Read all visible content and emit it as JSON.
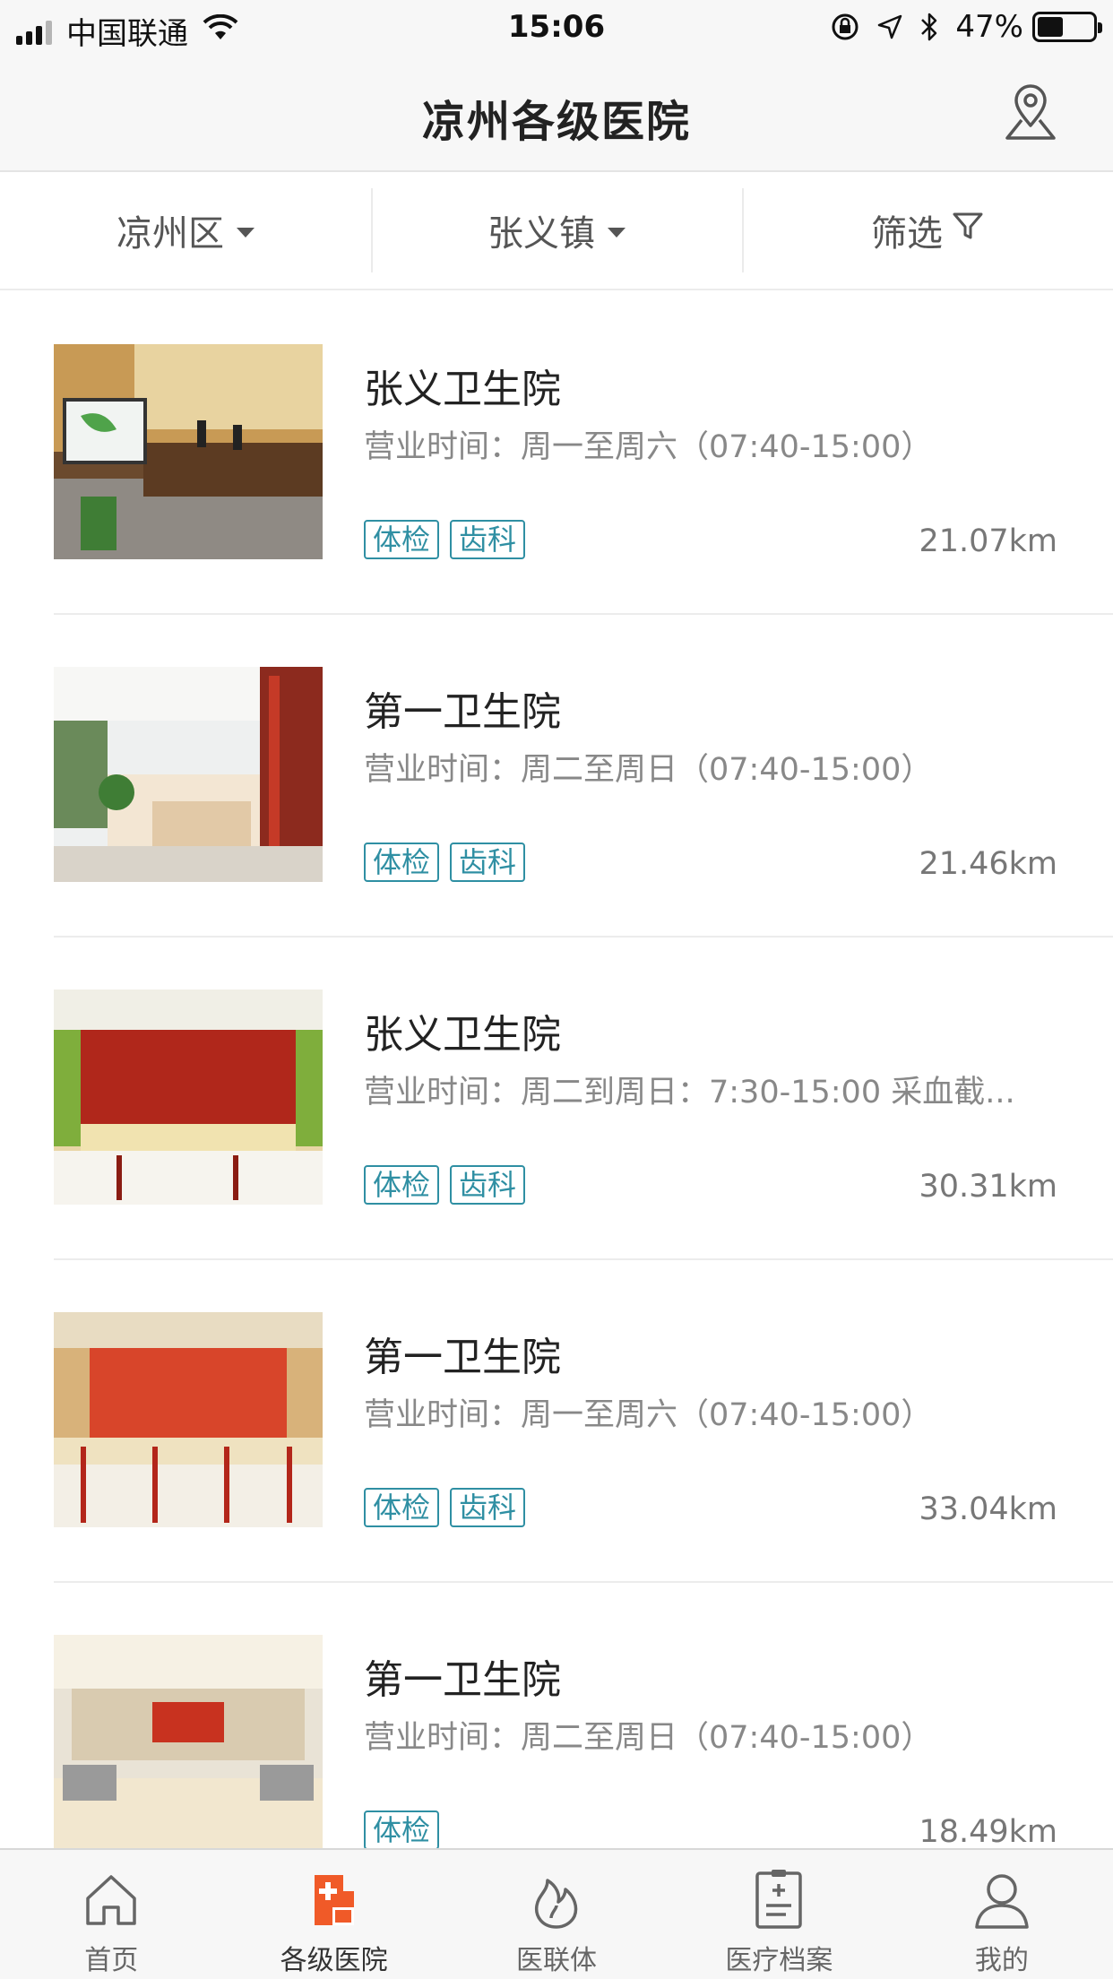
{
  "status_bar": {
    "carrier": "中国联通",
    "time": "15:06",
    "battery": "47%"
  },
  "nav": {
    "title": "凉州各级医院",
    "location_icon": "location-pin-icon"
  },
  "filters": [
    {
      "label": "凉州区",
      "icon": "caret-down-icon"
    },
    {
      "label": "张义镇",
      "icon": "caret-down-icon"
    },
    {
      "label": "筛选",
      "icon": "funnel-icon"
    }
  ],
  "hospitals": [
    {
      "name": "张义卫生院",
      "hours": "营业时间：周一至周六（07:40-15:00）",
      "tags": [
        "体检",
        "齿科"
      ],
      "distance": "21.07km"
    },
    {
      "name": "第一卫生院",
      "hours": "营业时间：周二至周日（07:40-15:00）",
      "tags": [
        "体检",
        "齿科"
      ],
      "distance": "21.46km"
    },
    {
      "name": "张义卫生院",
      "hours": "营业时间：周二到周日：7:30-15:00   采血截...",
      "tags": [
        "体检",
        "齿科"
      ],
      "distance": "30.31km"
    },
    {
      "name": "第一卫生院",
      "hours": "营业时间：周一至周六（07:40-15:00）",
      "tags": [
        "体检",
        "齿科"
      ],
      "distance": "33.04km"
    },
    {
      "name": "第一卫生院",
      "hours": "营业时间：周二至周日（07:40-15:00）",
      "tags": [
        "体检"
      ],
      "distance": "18.49km"
    }
  ],
  "tabs": [
    {
      "label": "首页",
      "icon": "home-icon"
    },
    {
      "label": "各级医院",
      "icon": "hospital-icon",
      "active": true
    },
    {
      "label": "医联体",
      "icon": "flame-icon"
    },
    {
      "label": "医疗档案",
      "icon": "medical-record-icon"
    },
    {
      "label": "我的",
      "icon": "person-icon"
    }
  ],
  "colors": {
    "accent": "#f05a28",
    "tag": "#2f8fa3"
  }
}
